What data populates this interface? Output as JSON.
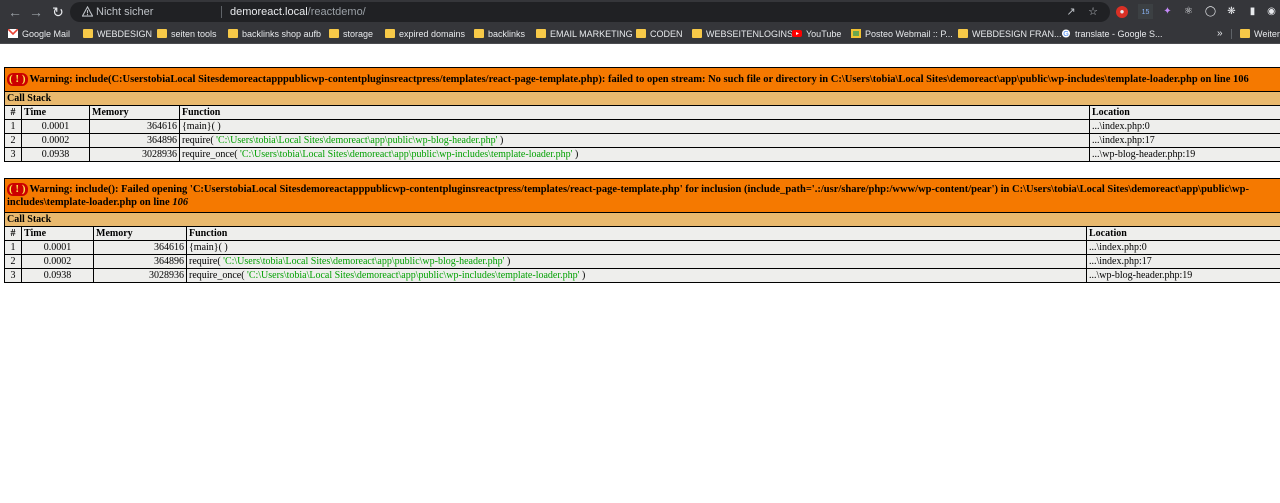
{
  "browser": {
    "security_label": "Nicht sicher",
    "url_host": "demoreact.local",
    "url_path": "/reactdemo/",
    "ext_badge": "15"
  },
  "bookmarks": {
    "items": [
      {
        "label": "Google Mail",
        "icon": "gmail-icon"
      },
      {
        "label": "WEBDESIGN",
        "icon": "folder-icon"
      },
      {
        "label": "seiten tools",
        "icon": "folder-icon"
      },
      {
        "label": "backlinks shop aufb",
        "icon": "folder-icon"
      },
      {
        "label": "storage",
        "icon": "folder-icon"
      },
      {
        "label": "expired domains",
        "icon": "folder-icon"
      },
      {
        "label": "backlinks",
        "icon": "folder-icon"
      },
      {
        "label": "EMAIL MARKETING",
        "icon": "folder-icon"
      },
      {
        "label": "CODEN",
        "icon": "folder-icon"
      },
      {
        "label": "WEBSEITENLOGINS",
        "icon": "folder-icon"
      },
      {
        "label": "YouTube",
        "icon": "youtube-icon"
      },
      {
        "label": "Posteo Webmail :: P...",
        "icon": "posteo-icon"
      },
      {
        "label": "WEBDESIGN FRAN...",
        "icon": "folder-icon"
      },
      {
        "label": "translate - Google S...",
        "icon": "google-icon"
      }
    ],
    "more": "»",
    "overflow_label": "Weiter"
  },
  "errors": [
    {
      "badge": "( ! )",
      "message": "Warning: include(C:UserstobiaLocal Sitesdemoreactapppublicwp-contentpluginsreactpress/templates/react-page-template.php): failed to open stream: No such file or directory in C:\\Users\\tobia\\Local Sites\\demoreact\\app\\public\\wp-includes\\template-loader.php on line 106",
      "line": "",
      "call_stack_label": "Call Stack",
      "headers": {
        "num": "#",
        "time": "Time",
        "memory": "Memory",
        "function": "Function",
        "location": "Location"
      },
      "rows": [
        {
          "num": "1",
          "time": "0.0001",
          "memory": "364616",
          "func": "{main}( )",
          "arg": "",
          "location": "...\\index.php:0"
        },
        {
          "num": "2",
          "time": "0.0002",
          "memory": "364896",
          "func": "require( ",
          "arg": "'C:\\Users\\tobia\\Local Sites\\demoreact\\app\\public\\wp-blog-header.php'",
          "close": " )",
          "location": "...\\index.php:17"
        },
        {
          "num": "3",
          "time": "0.0938",
          "memory": "3028936",
          "func": "require_once( ",
          "arg": "'C:\\Users\\tobia\\Local Sites\\demoreact\\app\\public\\wp-includes\\template-loader.php'",
          "close": " )",
          "location": "...\\wp-blog-header.php:19"
        }
      ]
    },
    {
      "badge": "( ! )",
      "message": "Warning: include(): Failed opening 'C:UserstobiaLocal Sitesdemoreactapppublicwp-contentpluginsreactpress/templates/react-page-template.php' for inclusion (include_path='.:/usr/share/php:/www/wp-content/pear') in C:\\Users\\tobia\\Local Sites\\demoreact\\app\\public\\wp-includes\\template-loader.php on line ",
      "line": "106",
      "call_stack_label": "Call Stack",
      "headers": {
        "num": "#",
        "time": "Time",
        "memory": "Memory",
        "function": "Function",
        "location": "Location"
      },
      "rows": [
        {
          "num": "1",
          "time": "0.0001",
          "memory": "364616",
          "func": "{main}( )",
          "arg": "",
          "location": "...\\index.php:0"
        },
        {
          "num": "2",
          "time": "0.0002",
          "memory": "364896",
          "func": "require( ",
          "arg": "'C:\\Users\\tobia\\Local Sites\\demoreact\\app\\public\\wp-blog-header.php'",
          "close": " )",
          "location": "...\\index.php:17"
        },
        {
          "num": "3",
          "time": "0.0938",
          "memory": "3028936",
          "func": "require_once( ",
          "arg": "'C:\\Users\\tobia\\Local Sites\\demoreact\\app\\public\\wp-includes\\template-loader.php'",
          "close": " )",
          "location": "...\\wp-blog-header.php:19"
        }
      ]
    }
  ]
}
